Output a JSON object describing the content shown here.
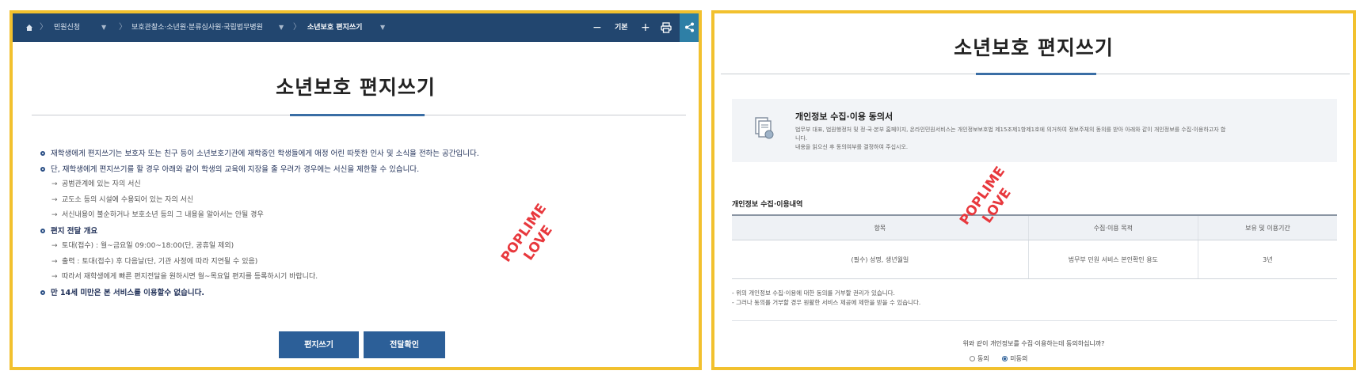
{
  "colors": {
    "frame": "#f2c12e",
    "header_bar": "#22466f",
    "accent": "#2c5f98",
    "watermark": "#e8383d"
  },
  "breadcrumb": {
    "items": [
      "민원신청",
      "보호관찰소·소년원·분류심사원·국립법무병원",
      "소년보호 편지쓰기"
    ],
    "zoom_minus": "−",
    "zoom_label": "기본",
    "zoom_plus": "+",
    "icons": [
      "home-icon",
      "print-icon",
      "share-icon"
    ]
  },
  "left": {
    "title": "소년보호 편지쓰기",
    "bullets": [
      {
        "type": "main",
        "text": "재학생에게 편지쓰기는 보호자 또는 친구 등이 소년보호기관에 재학중인 학생들에게 애정 어린 따뜻한 인사 및 소식을 전하는 공간입니다."
      },
      {
        "type": "main",
        "text": "단, 재학생에게 편지쓰기를 할 경우 아래와 같이 학생의 교육에 지장을 줄 우려가 경우에는 서신을 제한할 수 있습니다."
      },
      {
        "type": "sub",
        "text": "공범관계에 있는 자의 서신"
      },
      {
        "type": "sub",
        "text": "교도소 등의 시설에 수용되어 있는 자의 서신"
      },
      {
        "type": "sub",
        "text": "서신내용이 불순하거나 보호소년 등의 그 내용을 알아서는 안될 경우"
      },
      {
        "type": "main",
        "bold": true,
        "text": "편지 전달 개요"
      },
      {
        "type": "sub",
        "text": "토대(접수) : 월~금요일 09:00~18:00(단, 공휴일 제외)"
      },
      {
        "type": "sub",
        "text": "출력 : 토대(접수) 후 다음날(단, 기관 사정에 따라 지연될 수 있음)"
      },
      {
        "type": "sub",
        "text": "따라서 재학생에게 빠른 편지전달을 원하시면 월~목요일 편지를 등록하시기 바랍니다."
      },
      {
        "type": "main",
        "bold": true,
        "text": "만 14세 미만은 본 서비스를 이용할수 없습니다."
      }
    ],
    "buttons": {
      "write": "편지쓰기",
      "check": "전달확인"
    },
    "watermark": [
      "POPLIME",
      "LOVE"
    ]
  },
  "right": {
    "title": "소년보호 편지쓰기",
    "consent": {
      "heading": "개인정보 수집·이용 동의서",
      "text_lines": [
        "법무부 대표, 법원행정처 및 정·국·본부 홈페이지, 온라인민원서비스는 개인정보보호법 제15조제1항제1호에 의거하여 정보주체의 동의를 받아 아래와 같이 개인정보를 수집·이용하고자 합",
        "니다.",
        "내용을 읽으신 후 동의여부를 결정하여 주십시오."
      ]
    },
    "section_title": "개인정보 수집·이용내역",
    "table": {
      "headers": [
        "항목",
        "수집·이용 목적",
        "보유 및 이용기간"
      ],
      "rows": [
        [
          "(필수) 성명, 생년월일",
          "법무부 민원 서비스 본인확인 용도",
          "3년"
        ]
      ]
    },
    "notes": [
      "- 위의 개인정보 수집·이용에 대한 동의를 거부할 권리가 있습니다.",
      "- 그러나 동의를 거부할 경우 원활한 서비스 제공에 제한을 받을 수 있습니다."
    ],
    "question": "위와 같이 개인정보를 수집·이용하는데 동의하십니까?",
    "radio": {
      "agree": "동의",
      "disagree": "미동의",
      "selected": "disagree"
    },
    "watermark": [
      "POPLIME",
      "LOVE"
    ]
  }
}
